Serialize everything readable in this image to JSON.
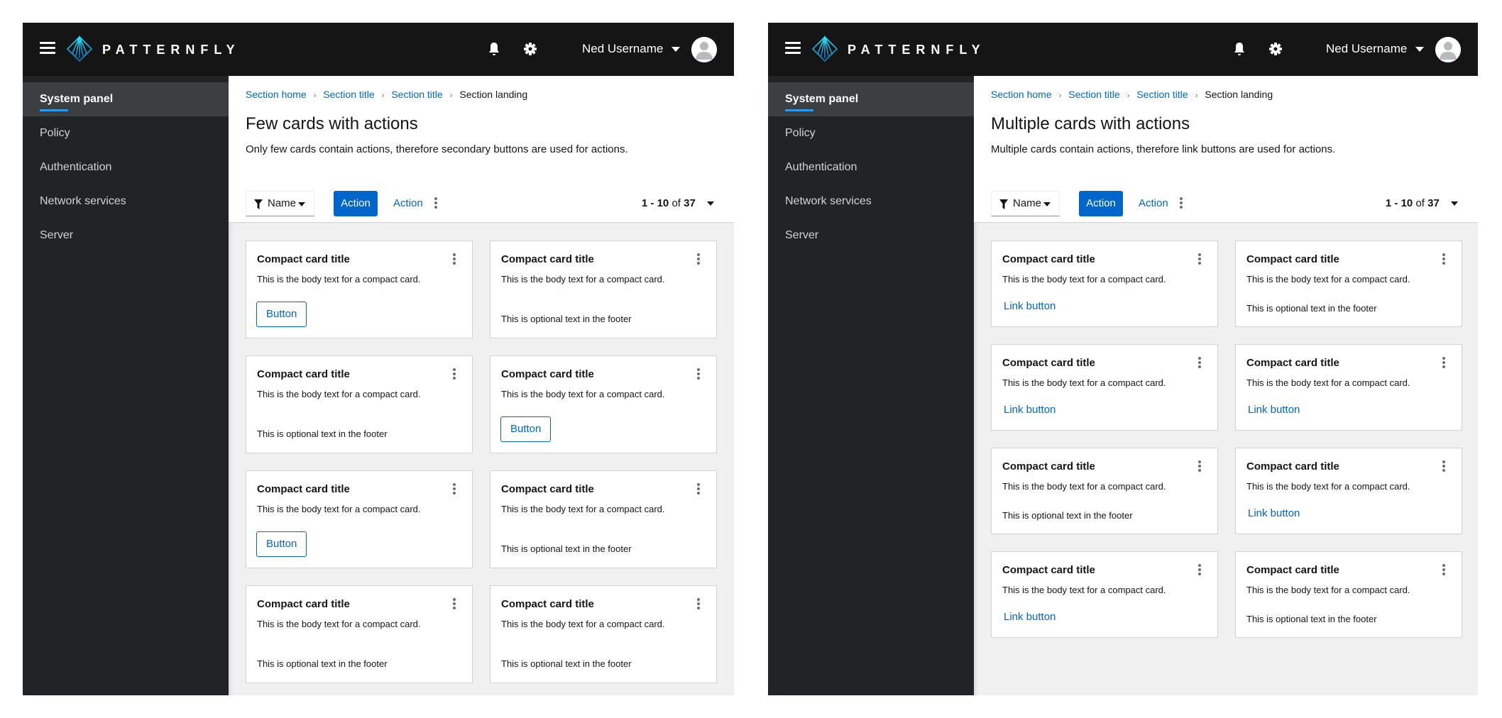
{
  "brand": "PATTERNFLY",
  "colors": {
    "masthead": "#151515",
    "sidebar": "#212427",
    "accent": "#0066cc",
    "nav_indicator": "#2b9af3"
  },
  "icons": {
    "menu": "hamburger-icon",
    "logo": "patternfly-logo-icon",
    "notifications": "bell-icon",
    "settings": "gear-icon",
    "user_menu": "caret-down-icon",
    "avatar": "user-avatar-icon",
    "filter": "filter-icon",
    "kebab": "kebab-vertical-icon",
    "breadcrumb_separator": "chevron-right-icon"
  },
  "header": {
    "username": "Ned Username"
  },
  "sidebar": {
    "items": [
      {
        "label": "System panel",
        "active": true
      },
      {
        "label": "Policy"
      },
      {
        "label": "Authentication"
      },
      {
        "label": "Network services"
      },
      {
        "label": "Server"
      }
    ]
  },
  "breadcrumb": {
    "separator": "›",
    "items": [
      "Section home",
      "Section title",
      "Section title"
    ],
    "current": "Section landing"
  },
  "toolbar": {
    "filter_label": "Name",
    "primary_action": "Action",
    "link_action": "Action",
    "pagination": {
      "range": "1 - 10",
      "of": "of",
      "total": "37"
    }
  },
  "card_common": {
    "title": "Compact card title",
    "body": "This is the body text for a compact card.",
    "footer_text": "This is optional text in the footer"
  },
  "panels": [
    {
      "id": "few",
      "title": "Few cards with actions",
      "description": "Only few cards contain actions, therefore secondary buttons are used for actions.",
      "action_label": "Button",
      "cards": [
        {
          "footer": "button"
        },
        {
          "footer": "text"
        },
        {
          "footer": "text"
        },
        {
          "footer": "button"
        },
        {
          "footer": "button"
        },
        {
          "footer": "text"
        },
        {
          "footer": "text"
        },
        {
          "footer": "text"
        }
      ]
    },
    {
      "id": "multiple",
      "title": "Multiple cards with actions",
      "description": "Multiple cards contain actions, therefore link buttons are used for actions.",
      "action_label": "Link button",
      "cards": [
        {
          "footer": "link"
        },
        {
          "footer": "text"
        },
        {
          "footer": "link"
        },
        {
          "footer": "link"
        },
        {
          "footer": "text"
        },
        {
          "footer": "link"
        },
        {
          "footer": "link"
        },
        {
          "footer": "text"
        }
      ]
    }
  ]
}
